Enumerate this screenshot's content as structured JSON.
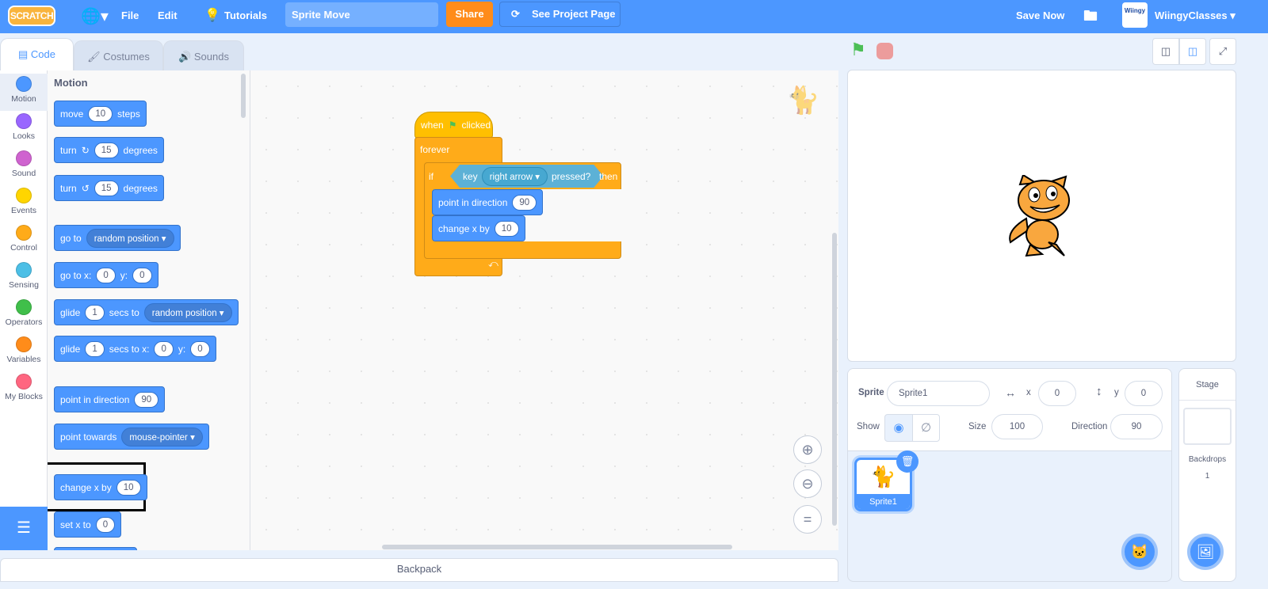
{
  "menubar": {
    "logo": "SCRATCH",
    "file": "File",
    "edit": "Edit",
    "tutorials": "Tutorials",
    "project_title": "Sprite Move",
    "share": "Share",
    "see_project_page": "See Project Page",
    "save_now": "Save Now",
    "username": "WiingyClasses",
    "avatar_text": "Wiingy"
  },
  "tabs": [
    {
      "label": "Code"
    },
    {
      "label": "Costumes"
    },
    {
      "label": "Sounds"
    }
  ],
  "categories": [
    {
      "label": "Motion",
      "color": "#4c97ff"
    },
    {
      "label": "Looks",
      "color": "#9966ff"
    },
    {
      "label": "Sound",
      "color": "#cf63cf"
    },
    {
      "label": "Events",
      "color": "#ffd500"
    },
    {
      "label": "Control",
      "color": "#ffab19"
    },
    {
      "label": "Sensing",
      "color": "#4cbfe6"
    },
    {
      "label": "Operators",
      "color": "#40bf4a"
    },
    {
      "label": "Variables",
      "color": "#ff8c1a"
    },
    {
      "label": "My Blocks",
      "color": "#ff6680"
    }
  ],
  "palette": {
    "heading": "Motion",
    "move": {
      "a": "move",
      "v": "10",
      "b": "steps"
    },
    "turn_cw": {
      "a": "turn",
      "v": "15",
      "b": "degrees"
    },
    "turn_ccw": {
      "a": "turn",
      "v": "15",
      "b": "degrees"
    },
    "goto": {
      "a": "go to",
      "dd": "random position"
    },
    "gotoxy": {
      "a": "go to x:",
      "x": "0",
      "b": "y:",
      "y": "0"
    },
    "glide": {
      "a": "glide",
      "v": "1",
      "b": "secs to",
      "dd": "random position"
    },
    "glidexy": {
      "a": "glide",
      "v": "1",
      "b": "secs to x:",
      "x": "0",
      "c": "y:",
      "y": "0"
    },
    "point": {
      "a": "point in direction",
      "v": "90"
    },
    "towards": {
      "a": "point towards",
      "dd": "mouse-pointer"
    },
    "changex": {
      "a": "change x by",
      "v": "10"
    },
    "setx": {
      "a": "set x to",
      "v": "0"
    }
  },
  "script": {
    "hat": {
      "a": "when",
      "b": "clicked"
    },
    "forever": "forever",
    "if": {
      "a": "if",
      "key": "key",
      "dd": "right arrow",
      "pressed": "pressed?",
      "then": "then"
    },
    "point": {
      "a": "point in direction",
      "v": "90"
    },
    "changex": {
      "a": "change x by",
      "v": "10"
    }
  },
  "backpack": "Backpack",
  "sprite_info": {
    "sprite_label": "Sprite",
    "sprite_name": "Sprite1",
    "x_label": "x",
    "x": "0",
    "y_label": "y",
    "y": "0",
    "show_label": "Show",
    "size_label": "Size",
    "size": "100",
    "direction_label": "Direction",
    "direction": "90"
  },
  "sprites": [
    {
      "name": "Sprite1",
      "selected": true
    }
  ],
  "stage_pane": {
    "title": "Stage",
    "backdrops_label": "Backdrops",
    "backdrops": "1"
  },
  "colors": {
    "menubar": "#4c97ff",
    "motion": "#4c97ff",
    "events": "#ffbf00",
    "control": "#ffab19",
    "sensing": "#5cb1d6",
    "share": "#ff8c1a"
  }
}
